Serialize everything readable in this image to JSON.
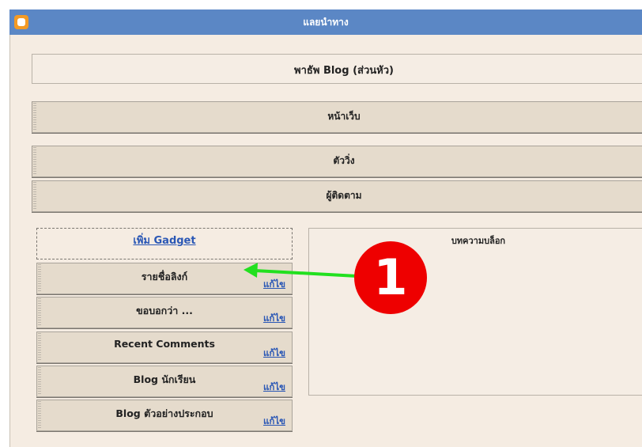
{
  "window": {
    "title": "แลยนำทาง"
  },
  "header": {
    "label": "พาธัพ Blog (ส่วนหัว)"
  },
  "bars": [
    {
      "label": "หน้าเว็บ"
    },
    {
      "label": "ตัววิ่ง"
    },
    {
      "label": "ผู้ติดตาม"
    }
  ],
  "sidebar": {
    "add_gadget": "เพิ่ม Gadget",
    "gadgets": [
      {
        "title": "รายชื่อลิงก์",
        "edit": "แก้ไข"
      },
      {
        "title": "ขอบอกว่า ...",
        "edit": "แก้ไข"
      },
      {
        "title": "Recent Comments",
        "edit": "แก้ไข"
      },
      {
        "title": "Blog นักเรียน",
        "edit": "แก้ไข"
      },
      {
        "title": "Blog ตัวอย่างประกอบ",
        "edit": "แก้ไข"
      }
    ]
  },
  "main": {
    "posts_label": "บทความบล็อก"
  },
  "annotation": {
    "step_number": "1",
    "arrow_color": "#22e01f",
    "badge_color": "#ee0000"
  }
}
